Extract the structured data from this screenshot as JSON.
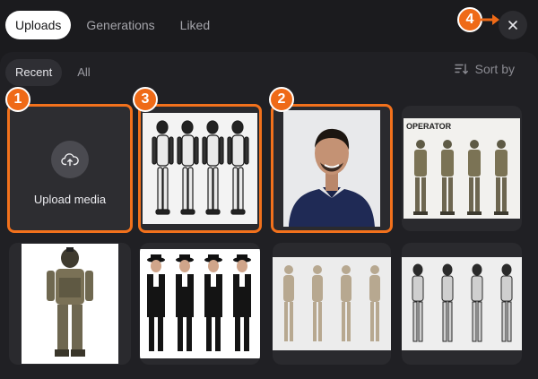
{
  "tabs": [
    {
      "label": "Uploads",
      "active": true
    },
    {
      "label": "Generations",
      "active": false
    },
    {
      "label": "Liked",
      "active": false
    }
  ],
  "filters": [
    {
      "label": "Recent",
      "active": true
    },
    {
      "label": "All",
      "active": false
    }
  ],
  "sort": {
    "label": "Sort by",
    "icon": "sort-icon"
  },
  "close": {
    "icon": "close-icon"
  },
  "upload": {
    "label": "Upload media",
    "icon": "cloud-upload-icon"
  },
  "thumbnails": [
    {
      "subject": "robot-turnaround",
      "poster_text": ""
    },
    {
      "subject": "man-portrait",
      "poster_text": ""
    },
    {
      "subject": "soldier-lineup",
      "poster_text": "OPERATOR"
    },
    {
      "subject": "soldier-standing",
      "poster_text": ""
    },
    {
      "subject": "men-in-black-hats",
      "poster_text": ""
    },
    {
      "subject": "mannequin-turnaround",
      "poster_text": ""
    },
    {
      "subject": "robot-turnaround-dark",
      "poster_text": ""
    }
  ],
  "annotations": [
    "1",
    "2",
    "3",
    "4"
  ],
  "colors": {
    "accent": "#ef6a17",
    "background": "#1b1b1e",
    "panel": "#202024"
  }
}
